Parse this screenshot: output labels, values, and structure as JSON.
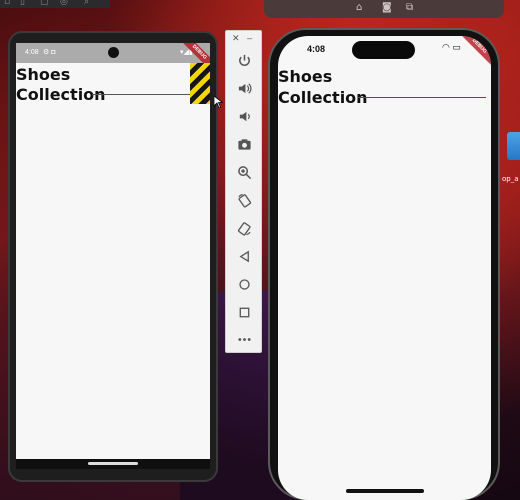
{
  "android": {
    "status_time": "4:08",
    "debug_label": "DEBUG",
    "title_line1": "Shoes",
    "title_line2": "Collection"
  },
  "ios": {
    "status_time": "4:08",
    "debug_label": "DEBUG",
    "title_line1": "Shoes",
    "title_line2": "Collection"
  },
  "desktop": {
    "icon_label": "op_a"
  },
  "colors": {
    "screen_bg": "#f7f7f7",
    "debug_ribbon": "#b5313a",
    "title_text": "#111111"
  }
}
